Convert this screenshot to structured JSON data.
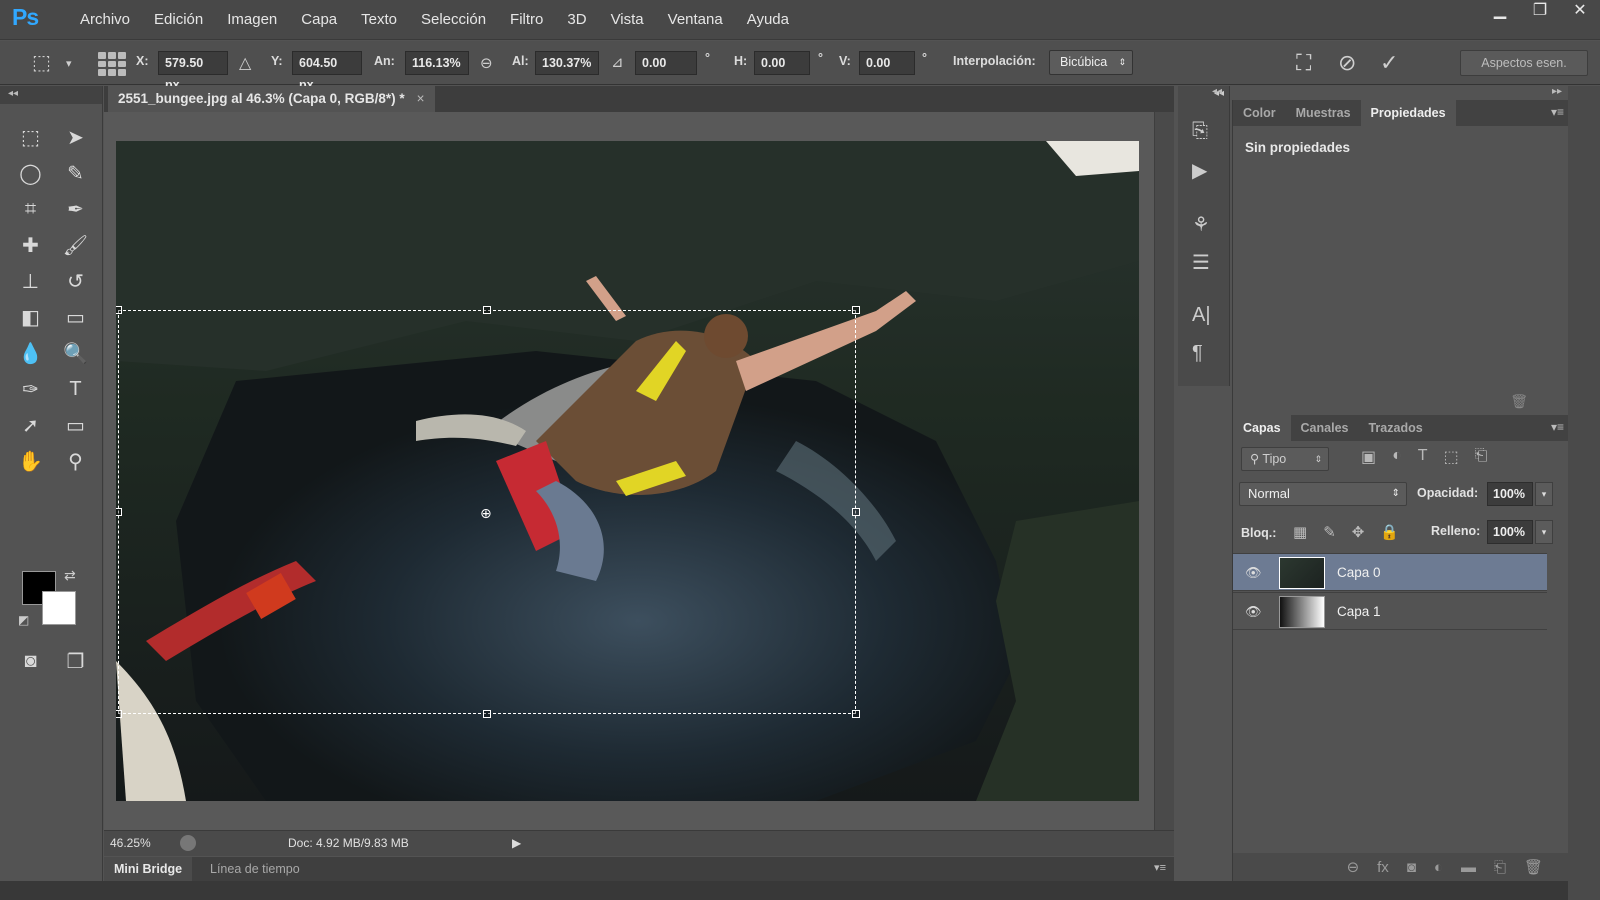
{
  "app": {
    "logo": "Ps",
    "menu": [
      "Archivo",
      "Edición",
      "Imagen",
      "Capa",
      "Texto",
      "Selección",
      "Filtro",
      "3D",
      "Vista",
      "Ventana",
      "Ayuda"
    ],
    "window_controls": {
      "minimize": "▁",
      "maximize": "❐",
      "close": "✕"
    }
  },
  "options": {
    "x_label": "X:",
    "x_value": "579.50 px",
    "y_label": "Y:",
    "y_value": "604.50 px",
    "w_label": "An:",
    "w_value": "116.13%",
    "h_label": "Al:",
    "h_value": "130.37%",
    "rotate_value": "0.00",
    "degree": "°",
    "hskew_label": "H:",
    "hskew_value": "0.00",
    "vskew_label": "V:",
    "vskew_value": "0.00",
    "interp_label": "Interpolación:",
    "interp_value": "Bicúbica",
    "workspace": "Aspectos esen."
  },
  "document": {
    "tab_title": "2551_bungee.jpg al 46.3% (Capa 0, RGB/8*) *",
    "close": "×",
    "zoom": "46.25%",
    "doc_info": "Doc: 4.92 MB/9.83 MB"
  },
  "bottom_tabs": [
    "Mini Bridge",
    "Línea de tiempo"
  ],
  "properties_panel": {
    "tabs": [
      "Color",
      "Muestras",
      "Propiedades"
    ],
    "active_tab": "Propiedades",
    "content": "Sin propiedades"
  },
  "layers_panel": {
    "tabs": [
      "Capas",
      "Canales",
      "Trazados"
    ],
    "filter": "Tipo",
    "blend_mode": "Normal",
    "opacity_label": "Opacidad:",
    "opacity_value": "100%",
    "lock_label": "Bloq.:",
    "fill_label": "Relleno:",
    "fill_value": "100%",
    "layers": [
      {
        "name": "Capa 0",
        "selected": true
      },
      {
        "name": "Capa 1",
        "selected": false
      }
    ]
  }
}
